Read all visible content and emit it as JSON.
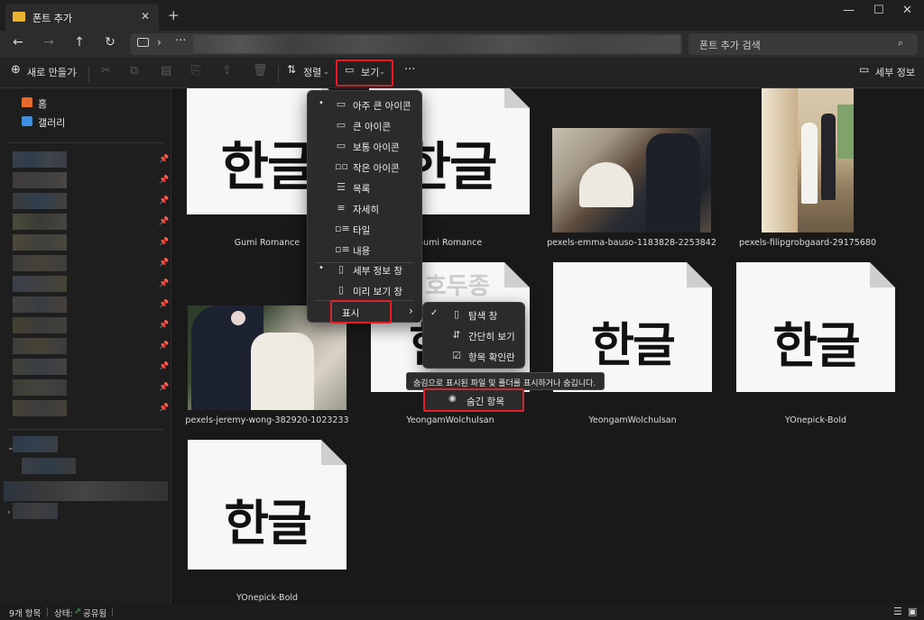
{
  "window": {
    "tab_title": "폰트 추가",
    "close_tab": "✕",
    "new_tab": "+",
    "minimize": "—",
    "maximize": "☐",
    "close": "✕"
  },
  "nav": {
    "back": "←",
    "forward": "→",
    "up": "↑",
    "refresh": "↻",
    "chevron": "›",
    "more": "···",
    "search_placeholder": "폰트 추가 검색",
    "search_icon": "⌕"
  },
  "toolbar": {
    "new_label": "새로 만들기",
    "new_icon": "⊕",
    "sort_label": "정렬",
    "view_label": "보기",
    "more": "···",
    "details_label": "세부 정보"
  },
  "sidebar": {
    "home": "홈",
    "gallery": "갤러리",
    "pin": "📌"
  },
  "files": [
    {
      "name": "Gumi Romance",
      "kind": "font",
      "glyph": "한글"
    },
    {
      "name": "Gumi Romance",
      "kind": "font",
      "glyph": "한글"
    },
    {
      "name": "pexels-emma-bauso-1183828-2253842",
      "kind": "photo"
    },
    {
      "name": "pexels-filipgrobgaard-29175680",
      "kind": "photo"
    },
    {
      "name": "pexels-jeremy-wong-382920-1023233",
      "kind": "photo"
    },
    {
      "name": "YeongamWolchulsan",
      "kind": "font",
      "glyph": "한글"
    },
    {
      "name": "YeongamWolchulsan",
      "kind": "font",
      "glyph": "한글"
    },
    {
      "name": "YOnepick-Bold",
      "kind": "font",
      "glyph": "한글"
    },
    {
      "name": "YOnepick-Bold",
      "kind": "font",
      "glyph": "한글"
    }
  ],
  "view_menu": {
    "items": [
      {
        "label": "아주 큰 아이콘",
        "icon": "▭",
        "selected": "•"
      },
      {
        "label": "큰 아이콘",
        "icon": "▭",
        "selected": ""
      },
      {
        "label": "보통 아이콘",
        "icon": "▭",
        "selected": ""
      },
      {
        "label": "작은 아이콘",
        "icon": "▫▫",
        "selected": ""
      },
      {
        "label": "목록",
        "icon": "☰",
        "selected": ""
      },
      {
        "label": "자세히",
        "icon": "≡",
        "selected": ""
      },
      {
        "label": "타일",
        "icon": "▫≡",
        "selected": ""
      },
      {
        "label": "내용",
        "icon": "▫≡",
        "selected": ""
      }
    ],
    "panes": [
      {
        "label": "세부 정보 창",
        "icon": "▯",
        "selected": "•"
      },
      {
        "label": "미리 보기 창",
        "icon": "▯",
        "selected": ""
      }
    ],
    "show_label": "표시",
    "show_arrow": "›"
  },
  "show_submenu": {
    "items": [
      {
        "label": "탐색 창",
        "icon": "▯",
        "check": "✓"
      },
      {
        "label": "간단히 보기",
        "icon": "⇵",
        "check": ""
      },
      {
        "label": "항목 확인란",
        "icon": "☑",
        "check": ""
      }
    ],
    "hidden_items_label": "숨긴 항목",
    "hidden_items_icon": "◉"
  },
  "tooltip": "숨김으로 표시된 파일 및 폴더를 표시하거나 숨깁니다.",
  "status": {
    "count": "9개 항목",
    "state_label": "상태:",
    "state_value": "공유됨"
  }
}
